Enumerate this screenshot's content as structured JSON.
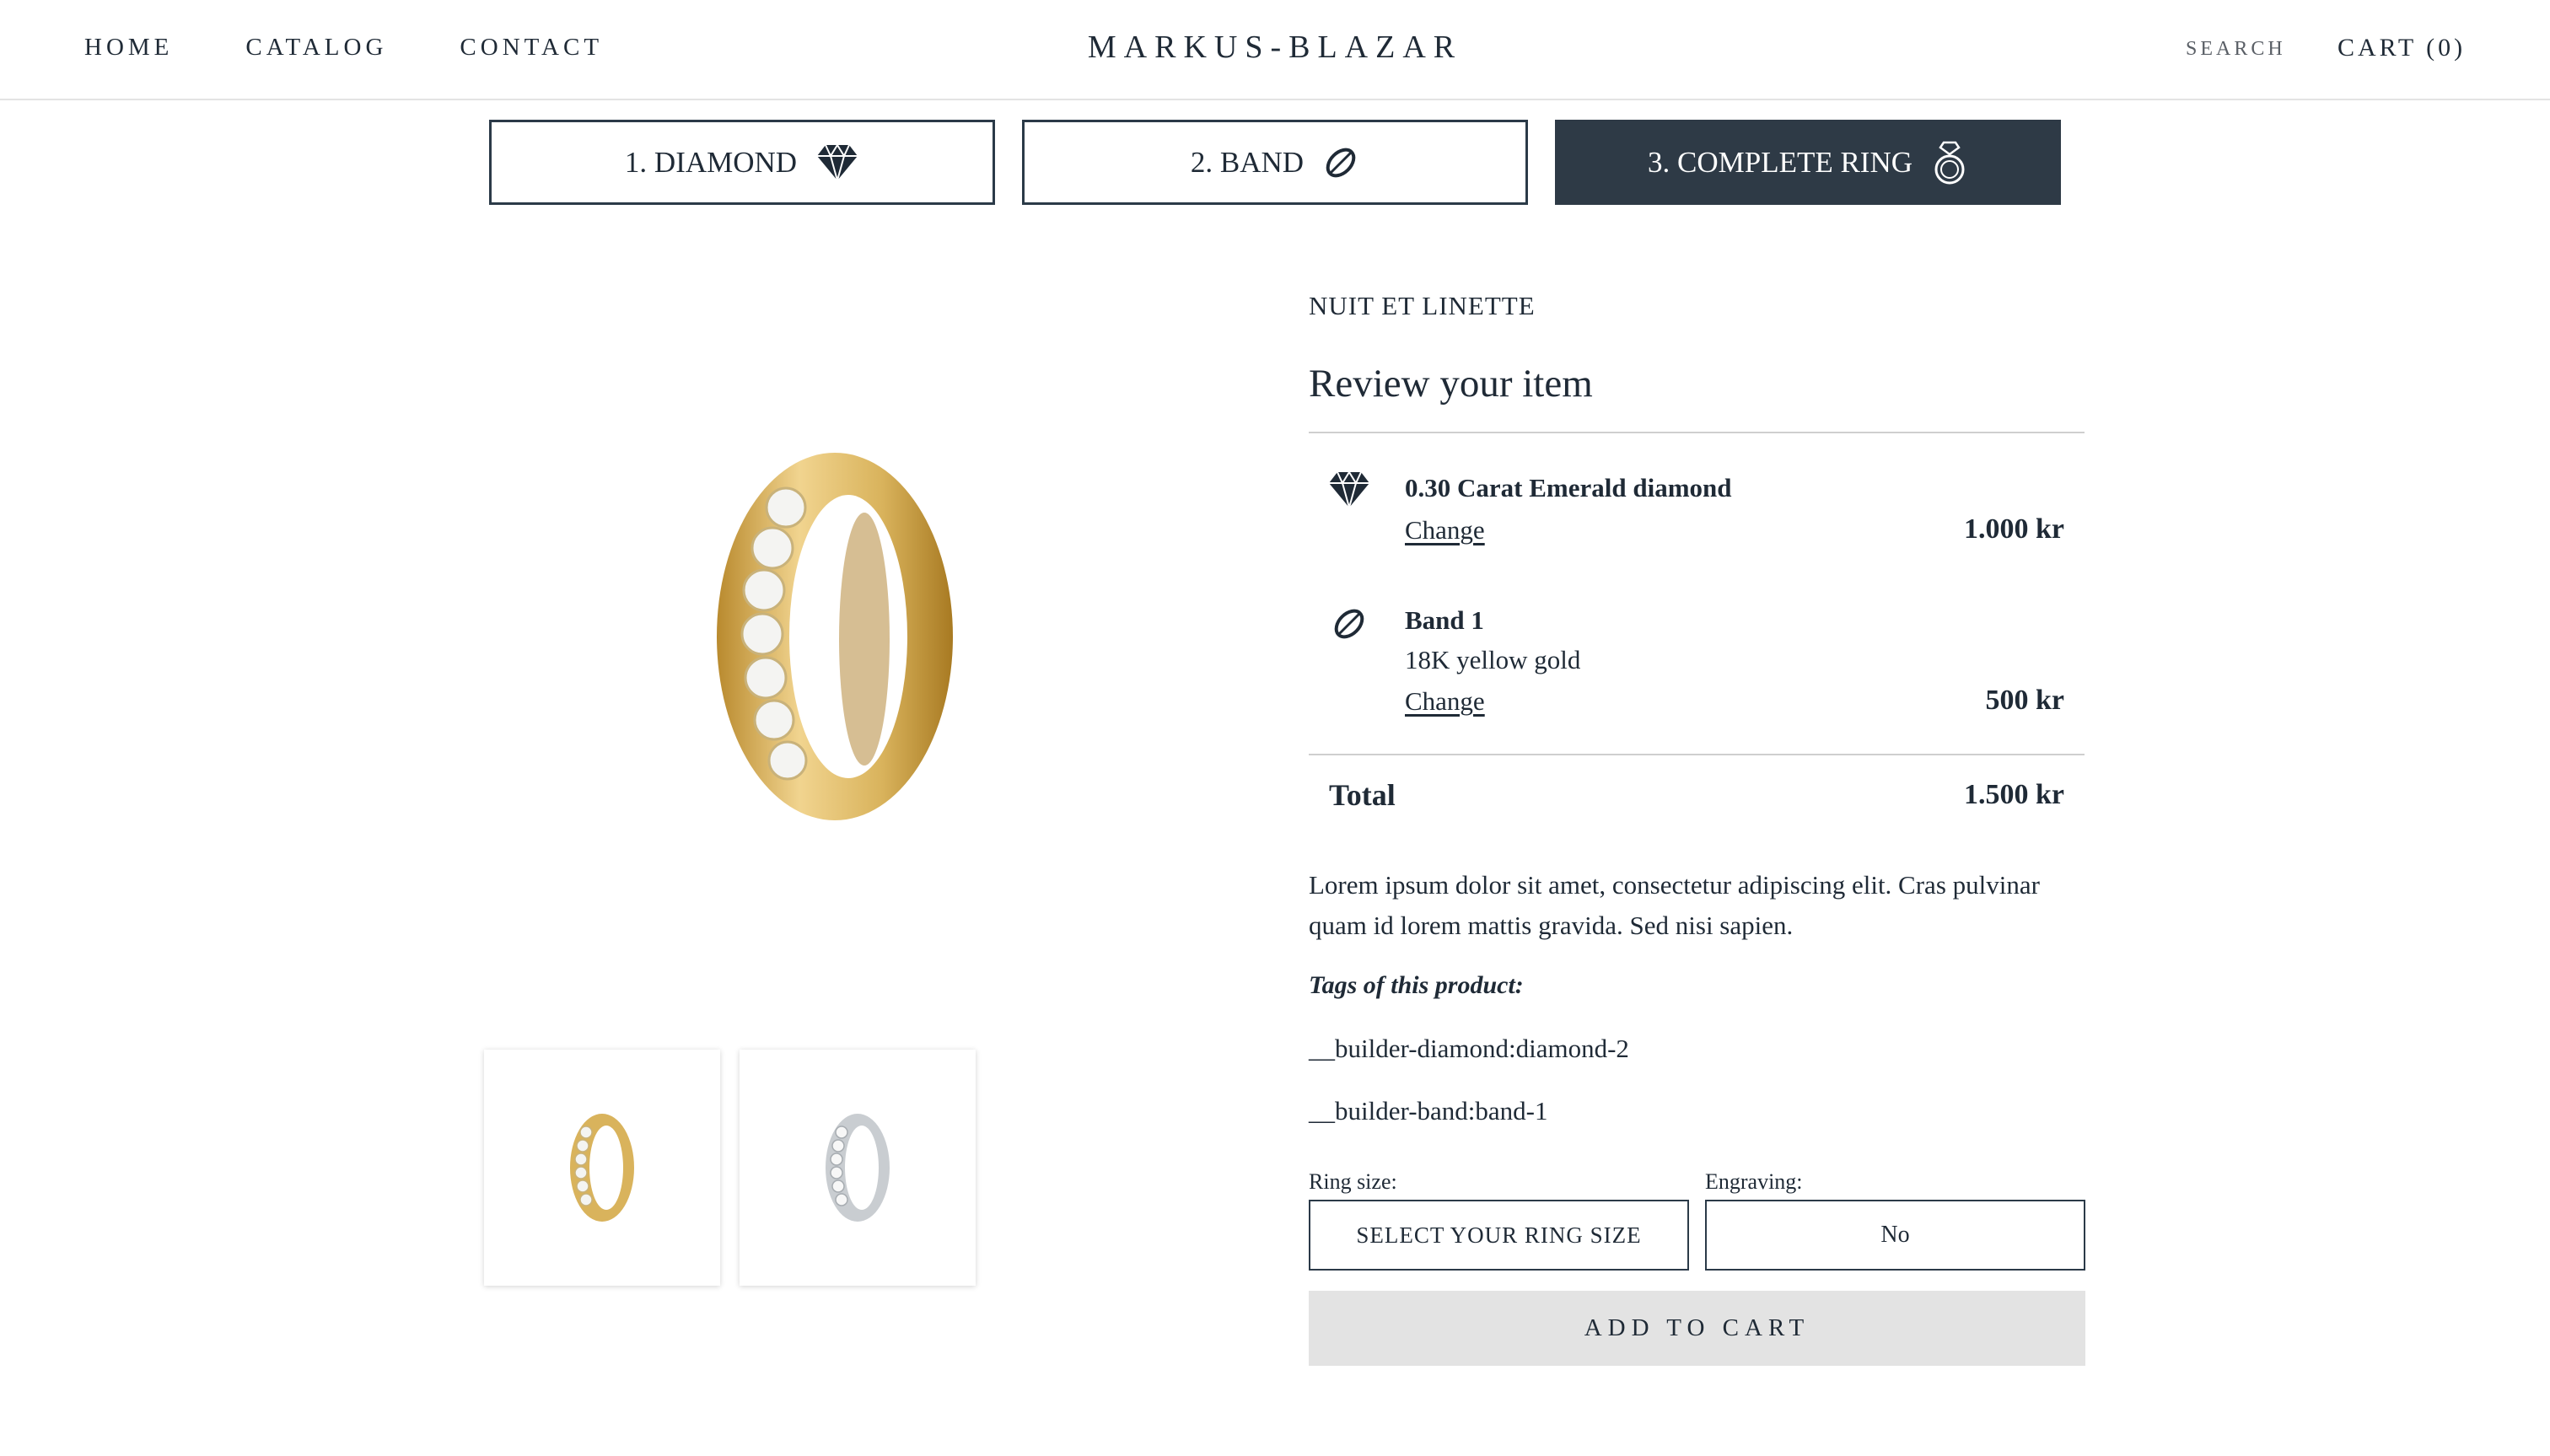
{
  "header": {
    "nav": [
      "HOME",
      "CATALOG",
      "CONTACT"
    ],
    "logo": "MARKUS-BLAZAR",
    "search_label": "SEARCH",
    "cart_label": "CART (0)"
  },
  "steps": [
    {
      "label": "1. DIAMOND",
      "icon": "diamond-icon",
      "active": false
    },
    {
      "label": "2. BAND",
      "icon": "band-icon",
      "active": false
    },
    {
      "label": "3. COMPLETE RING",
      "icon": "ring-icon",
      "active": true
    }
  ],
  "product": {
    "vendor": "NUIT ET LINETTE",
    "title": "Review your item",
    "items": [
      {
        "name": "0.30 Carat Emerald diamond",
        "icon": "diamond-icon",
        "change_label": "Change",
        "price": "1.000 kr"
      },
      {
        "name": "Band 1",
        "subtitle": "18K yellow gold",
        "icon": "band-icon",
        "change_label": "Change",
        "price": "500 kr"
      }
    ],
    "total_label": "Total",
    "total_price": "1.500 kr",
    "description": "Lorem ipsum dolor sit amet, consectetur adipiscing elit. Cras pulvinar quam id lorem mattis gravida. Sed nisi sapien.",
    "tags_label": "Tags of this product:",
    "tags": [
      "__builder-diamond:diamond-2",
      "__builder-band:band-1"
    ],
    "ring_size_label": "Ring size:",
    "ring_size_value": "SELECT YOUR RING SIZE",
    "engraving_label": "Engraving:",
    "engraving_value": "No",
    "add_to_cart_label": "ADD TO CART"
  },
  "colors": {
    "dark": "#2e3a46",
    "gold": "#d7b86b",
    "silver": "#c9cdd1",
    "button_bg": "#e3e3e3"
  }
}
